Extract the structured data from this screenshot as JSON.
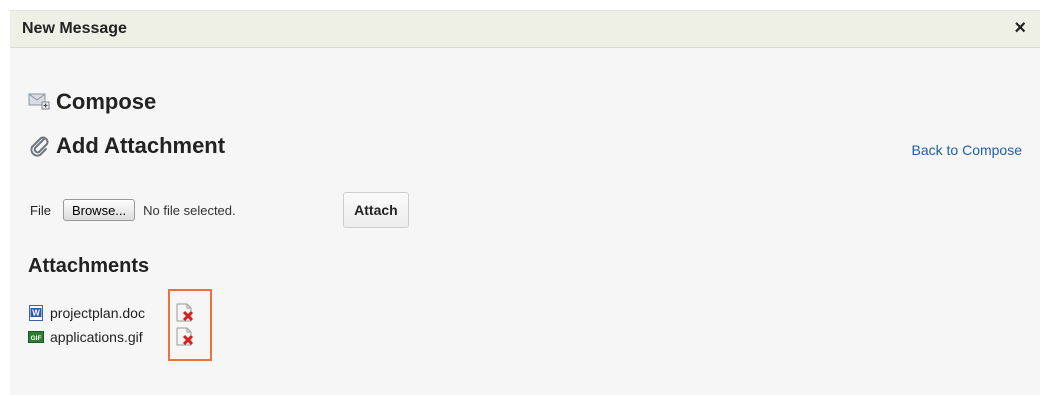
{
  "dialog": {
    "title": "New Message",
    "close_glyph": "×"
  },
  "compose": {
    "heading": "Compose",
    "icon": "compose-mail-icon"
  },
  "add_attachment": {
    "heading": "Add Attachment",
    "icon": "paperclip-icon",
    "back_link": "Back to Compose"
  },
  "file_input": {
    "label": "File",
    "browse_label": "Browse...",
    "status": "No file selected.",
    "attach_label": "Attach"
  },
  "attachments": {
    "heading": "Attachments",
    "items": [
      {
        "name": "projectplan.doc",
        "icon": "word-document-icon",
        "delete_icon": "delete-file-icon"
      },
      {
        "name": "applications.gif",
        "icon": "gif-image-icon",
        "delete_icon": "delete-file-icon"
      }
    ]
  },
  "colors": {
    "link": "#1f5fa7",
    "highlight_border": "#e8743b",
    "titlebar_bg": "#eef0e6",
    "panel_bg": "#f6f6f6"
  }
}
